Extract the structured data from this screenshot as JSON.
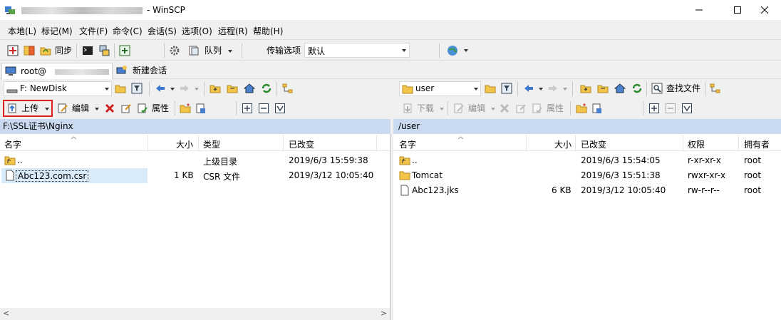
{
  "window": {
    "title": "- WinSCP"
  },
  "menu": [
    "本地(L)",
    "标记(M)",
    "文件(F)",
    "命令(C)",
    "会话(S)",
    "选项(O)",
    "远程(R)",
    "帮助(H)"
  ],
  "toolbar": {
    "sync": "同步",
    "queue": "队列",
    "transfer_label": "传输选项",
    "transfer_value": "默认"
  },
  "sessions": {
    "current": "root@",
    "new": "新建会话"
  },
  "left": {
    "drive": "F: NewDisk",
    "upload": "上传",
    "edit": "编辑",
    "props": "属性",
    "path": "F:\\SSL证书\\Nginx",
    "cols": {
      "name": "名字",
      "size": "大小",
      "type": "类型",
      "changed": "已改变"
    },
    "rows": [
      {
        "name": "..",
        "size": "",
        "type": "上级目录",
        "changed": "2019/6/3  15:59:38"
      },
      {
        "name": "Abc123.com.csr",
        "size": "1 KB",
        "type": "CSR 文件",
        "changed": "2019/3/12  10:05:40"
      }
    ]
  },
  "right": {
    "dir": "user",
    "find": "查找文件",
    "download": "下载",
    "edit": "编辑",
    "props": "属性",
    "path": "/user",
    "cols": {
      "name": "名字",
      "size": "大小",
      "changed": "已改变",
      "perm": "权限",
      "owner": "拥有者"
    },
    "rows": [
      {
        "name": "..",
        "size": "",
        "changed": "2019/6/3 15:54:05",
        "perm": "r-xr-xr-x",
        "owner": "root"
      },
      {
        "name": "Tomcat",
        "size": "",
        "changed": "2019/6/3 15:51:38",
        "perm": "rwxr-xr-x",
        "owner": "root"
      },
      {
        "name": "Abc123.jks",
        "size": "6 KB",
        "changed": "2019/3/12 10:05:40",
        "perm": "rw-r--r--",
        "owner": "root"
      }
    ]
  },
  "colors": {
    "path_bg": "#c9daf0",
    "highlight": "#d9ebf9",
    "upload_border": "#e02020"
  }
}
